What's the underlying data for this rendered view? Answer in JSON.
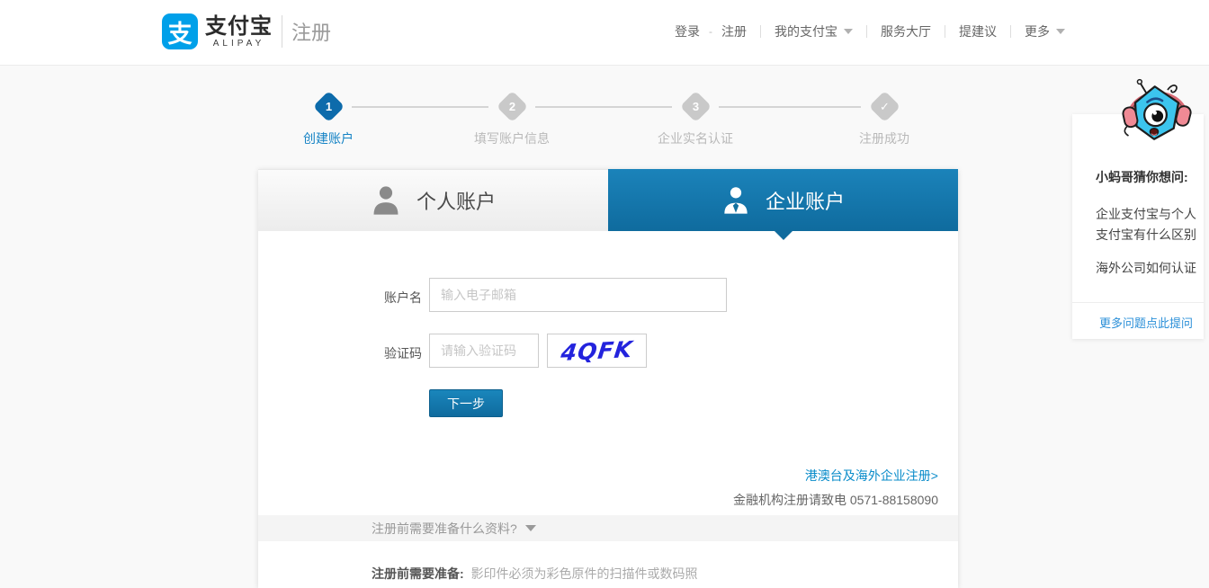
{
  "header": {
    "logo_glyph": "支",
    "brand": "支付宝",
    "brand_en": "ALIPAY",
    "page_label": "注册",
    "nav": {
      "login": "登录",
      "dash": "-",
      "register": "注册",
      "my_alipay": "我的支付宝",
      "service_hall": "服务大厅",
      "feedback": "提建议",
      "more": "更多"
    }
  },
  "steps": [
    {
      "num": "1",
      "label": "创建账户"
    },
    {
      "num": "2",
      "label": "填写账户信息"
    },
    {
      "num": "3",
      "label": "企业实名认证"
    },
    {
      "num": "✓",
      "label": "注册成功"
    }
  ],
  "tabs": {
    "personal": "个人账户",
    "enterprise": "企业账户"
  },
  "form": {
    "account_label": "账户名",
    "account_placeholder": "输入电子邮箱",
    "captcha_label": "验证码",
    "captcha_placeholder": "请输入验证码",
    "captcha_code": "4QFK",
    "next_button": "下一步",
    "overseas_link": "港澳台及海外企业注册>",
    "finance_hotline": "金融机构注册请致电 0571-88158090"
  },
  "prep": {
    "question": "注册前需要准备什么资料?",
    "note_label": "注册前需要准备:",
    "note_text": "影印件必须为彩色原件的扫描件或数码照"
  },
  "helper": {
    "title": "小蚂哥猜你想问:",
    "question1": "企业支付宝与个人支付宝有什么区别",
    "question2": "海外公司如何认证",
    "more_link": "更多问题点此提问"
  },
  "icons": {
    "check": "✓",
    "chevron_down": "▼ (css triangle)",
    "person": "gray person silhouette",
    "business_person": "white person with tie silhouette",
    "mascot": "xiao-ma-ge robot"
  },
  "colors": {
    "brand_blue": "#00a0e9",
    "primary_blue": "#1577ad",
    "step_active_blue": "#0d6bab",
    "link_blue": "#0a8cca",
    "captcha_blue": "#2323dd",
    "page_bg": "#f9f9f9"
  }
}
